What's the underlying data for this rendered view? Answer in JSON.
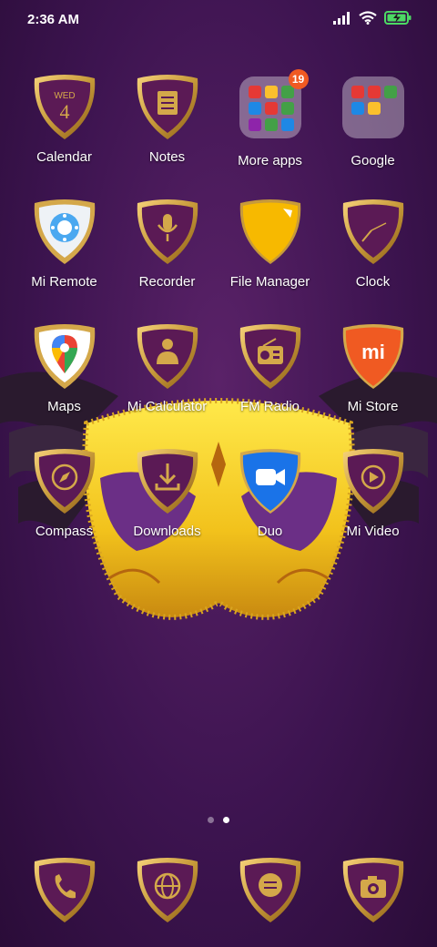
{
  "status": {
    "time": "2:36 AM",
    "battery": "charging"
  },
  "apps": [
    {
      "label": "Calendar",
      "icon": "calendar-icon",
      "day": "WED",
      "date": "4"
    },
    {
      "label": "Notes",
      "icon": "notes-icon"
    },
    {
      "label": "More apps",
      "icon": "folder-icon",
      "badge": "19"
    },
    {
      "label": "Google",
      "icon": "folder-icon"
    },
    {
      "label": "Mi Remote",
      "icon": "remote-icon"
    },
    {
      "label": "Recorder",
      "icon": "microphone-icon"
    },
    {
      "label": "File Manager",
      "icon": "file-manager-icon"
    },
    {
      "label": "Clock",
      "icon": "clock-icon"
    },
    {
      "label": "Maps",
      "icon": "maps-pin-icon"
    },
    {
      "label": "Mi Calculator",
      "icon": "calculator-icon"
    },
    {
      "label": "FM Radio",
      "icon": "radio-icon"
    },
    {
      "label": "Mi Store",
      "icon": "mi-store-icon",
      "logo_text": "mi"
    },
    {
      "label": "Compass",
      "icon": "compass-icon"
    },
    {
      "label": "Downloads",
      "icon": "download-icon"
    },
    {
      "label": "Duo",
      "icon": "video-camera-icon"
    },
    {
      "label": "Mi Video",
      "icon": "play-icon"
    }
  ],
  "page_indicator": {
    "count": 2,
    "active": 1
  },
  "dock": [
    {
      "icon": "phone-icon"
    },
    {
      "icon": "globe-icon"
    },
    {
      "icon": "message-icon"
    },
    {
      "icon": "camera-icon"
    }
  ],
  "colors": {
    "shield_purple": "#5b1a55",
    "gold": "#c79a3a",
    "accent_orange": "#f05a22",
    "duo_blue": "#1a73e8"
  }
}
